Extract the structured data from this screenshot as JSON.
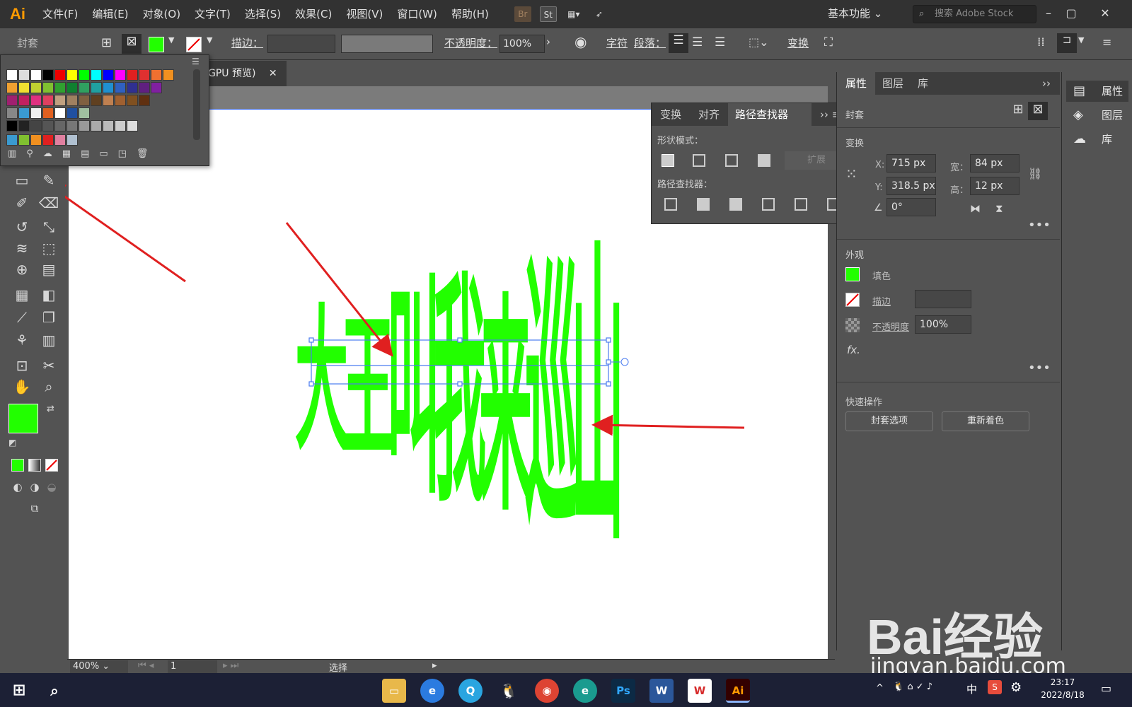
{
  "app": {
    "logo": "Ai",
    "menus": [
      "文件(F)",
      "编辑(E)",
      "对象(O)",
      "文字(T)",
      "选择(S)",
      "效果(C)",
      "视图(V)",
      "窗口(W)",
      "帮助(H)"
    ],
    "workspace": "基本功能",
    "stock_search_placeholder": "搜索 Adobe Stock",
    "bridge": "Br",
    "stock": "St"
  },
  "controlbar": {
    "envelope_label": "封套",
    "fill_color": "#22ff00",
    "stroke_label": "描边：",
    "opacity_label": "不透明度：",
    "opacity_value": "100%",
    "char_label": "字符",
    "para_label": "段落：",
    "transform_label": "变换"
  },
  "document": {
    "tab_title": "GPU 预览)",
    "artwork_text": "大王叫我来巡山",
    "artwork_color": "#22ff00"
  },
  "pathfinder": {
    "tabs": [
      "变换",
      "对齐",
      "路径查找器"
    ],
    "shape_modes_label": "形状模式：",
    "expand_label": "扩展",
    "pathfinders_label": "路径查找器："
  },
  "properties": {
    "tabs": [
      "属性",
      "图层",
      "库"
    ],
    "object_type": "封套",
    "transform_section": "变换",
    "x_label": "X:",
    "x_value": "715 px",
    "y_label": "Y:",
    "y_value": "318.5 px",
    "w_label": "宽：",
    "w_value": "84 px",
    "h_label": "高：",
    "h_value": "12 px",
    "angle_value": "0°",
    "appearance_section": "外观",
    "fill_label": "填色",
    "stroke_label": "描边",
    "opacity_label": "不透明度",
    "opacity_value": "100%",
    "fx_label": "fx.",
    "quick_actions_section": "快速操作",
    "envelope_options_button": "封套选项",
    "recolor_button": "重新着色"
  },
  "dock": {
    "items": [
      "属性",
      "图层",
      "库"
    ]
  },
  "statusbar": {
    "zoom": "400%",
    "artboard_number": "1",
    "tool_name": "选择"
  },
  "taskbar": {
    "time": "23:17",
    "date": "2022/8/18",
    "ime": "中"
  },
  "watermark": {
    "brand": "Bai经验",
    "url": "jingyan.baidu.com"
  }
}
